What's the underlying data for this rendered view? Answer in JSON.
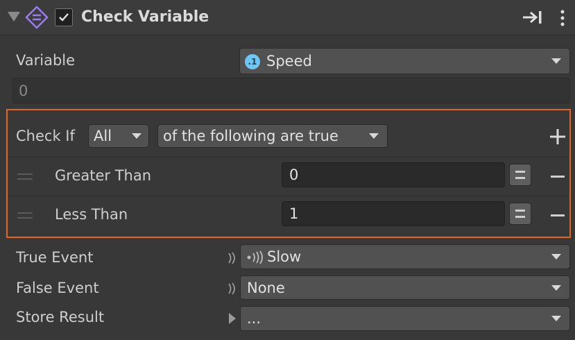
{
  "header": {
    "title": "Check Variable",
    "enabled": true,
    "collapse_icon": "triangle-down-icon",
    "type_icon": "check-variable-icon",
    "dock_icon": "arrow-to-right-icon",
    "menu_icon": "kebab-menu-icon"
  },
  "variable": {
    "label": "Variable",
    "selected": "Speed",
    "type_badge": ".1",
    "value": "0"
  },
  "conditions": {
    "check_if_label": "Check If",
    "mode": "All",
    "suffix": "of the following are true",
    "add_icon": "plus-icon",
    "rows": [
      {
        "label": "Greater Than",
        "value": "0"
      },
      {
        "label": "Less Than",
        "value": "1"
      }
    ],
    "highlight_color": "#e8661a"
  },
  "events": {
    "true_event": {
      "label": "True Event",
      "value": "Slow",
      "icon": "signal-icon"
    },
    "false_event": {
      "label": "False Event",
      "value": "None"
    },
    "store_result": {
      "label": "Store Result",
      "value": "..."
    }
  }
}
